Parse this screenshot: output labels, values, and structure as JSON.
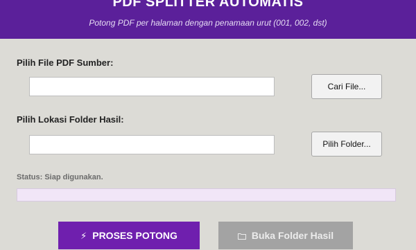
{
  "header": {
    "title": "PDF SPLITTER AUTOMATIS",
    "subtitle": "Potong PDF per halaman dengan penamaan urut (001, 002, dst)"
  },
  "source": {
    "label": "Pilih File PDF Sumber:",
    "value": "",
    "button_label": "Cari File..."
  },
  "output": {
    "label": "Pilih Lokasi Folder Hasil:",
    "value": "",
    "button_label": "Pilih Folder..."
  },
  "status": {
    "text": "Status: Siap digunakan.",
    "progress": 0
  },
  "actions": {
    "proses_label": "PROSES POTONG",
    "proses_icon": "lightning-icon",
    "buka_label": "Buka Folder Hasil",
    "buka_icon": "folder-icon",
    "buka_enabled": false
  },
  "colors": {
    "header_bg": "#5b209a",
    "accent": "#6f1fae",
    "disabled": "#a3a3a3",
    "progress_track": "#f1e6f7"
  }
}
